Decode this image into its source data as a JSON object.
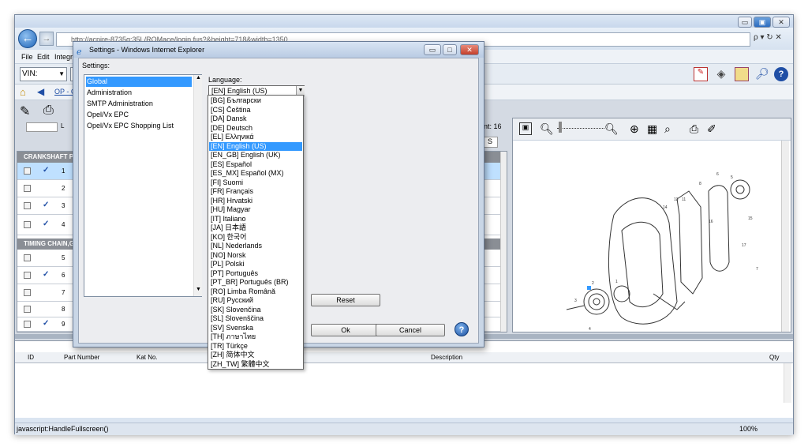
{
  "browser": {
    "url": "http://acpire-8735g:35L/ROMace/login.fus?&height=718&width=1350",
    "menu": [
      "File",
      "Edit",
      "Integra"
    ],
    "window_buttons": [
      "▭",
      "▣",
      "✕"
    ],
    "zoom": "100%",
    "status_text": "javascript:HandleFullscreen()",
    "search_icons": "ρ ▾ ↻ ✕"
  },
  "app": {
    "vin_label": "VIN:",
    "breadcrumb": "OP - C",
    "count_label": "nt: 16",
    "col_s": "S",
    "col_l": "L",
    "section1": "CRANKSHAFT PU",
    "section2": "TIMING CHAIN,GI",
    "rows": [
      {
        "num": "1",
        "checked": true,
        "selected": true
      },
      {
        "num": "2",
        "checked": false
      },
      {
        "num": "3",
        "checked": true
      },
      {
        "num": "4",
        "checked": true
      },
      {
        "num": "5",
        "checked": false
      },
      {
        "num": "6",
        "checked": true
      },
      {
        "num": "7",
        "checked": false
      },
      {
        "num": "8",
        "checked": false
      },
      {
        "num": "9",
        "checked": true
      }
    ],
    "grid_headers": {
      "id": "ID",
      "part_number": "Part Number",
      "kat_no": "Kat No.",
      "description": "Description",
      "qty": "Qty"
    }
  },
  "dialog": {
    "title": "Settings - Windows Internet Explorer",
    "settings_label": "Settings:",
    "nav_items": [
      "Global",
      "Administration",
      "SMTP Administration",
      "Opel/Vx EPC",
      "Opel/Vx EPC Shopping List"
    ],
    "language_label": "Language:",
    "selected_language": "[EN] English (US)",
    "reset_label": "Reset",
    "ok_label": "Ok",
    "cancel_label": "Cancel",
    "languages": [
      "[BG] Български",
      "[CS] Čeština",
      "[DA] Dansk",
      "[DE] Deutsch",
      "[EL] Ελληνικά",
      "[EN] English (US)",
      "[EN_GB] English (UK)",
      "[ES] Español",
      "[ES_MX] Español (MX)",
      "[FI] Suomi",
      "[FR] Français",
      "[HR] Hrvatski",
      "[HU] Magyar",
      "[IT] Italiano",
      "[JA] 日本語",
      "[KO] 한국어",
      "[NL] Nederlands",
      "[NO] Norsk",
      "[PL] Polski",
      "[PT] Português",
      "[PT_BR] Português (BR)",
      "[RO] Limba Română",
      "[RU] Русский",
      "[SK] Slovenčina",
      "[SL] Slovenščina",
      "[SV] Svenska",
      "[TH] ภาษาไทย",
      "[TR] Türkçe",
      "[ZH] 简体中文",
      "[ZH_TW] 繁體中文"
    ]
  }
}
